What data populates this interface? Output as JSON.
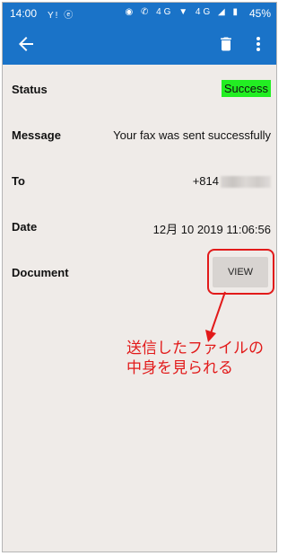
{
  "status_bar": {
    "time": "14:00",
    "left_icons": "Y! ⓔ",
    "right_icons": "◉ ✆ 4G ▼ 4G ◢ ▮",
    "battery": "45%"
  },
  "app_bar": {
    "back_icon": "arrow-left-icon",
    "trash_icon": "trash-icon",
    "more_icon": "more-vert-icon"
  },
  "details": {
    "status": {
      "label": "Status",
      "value": "Success"
    },
    "message": {
      "label": "Message",
      "value": "Your fax was sent successfully"
    },
    "to": {
      "label": "To",
      "value": "+814"
    },
    "date": {
      "label": "Date",
      "value": "12月 10 2019 11:06:56"
    },
    "document": {
      "label": "Document",
      "button": "VIEW"
    }
  },
  "annotation": {
    "line1": "送信したファイルの",
    "line2": "中身を見られる"
  },
  "colors": {
    "app_bar": "#1a73c8",
    "background": "#efebe8",
    "success": "#22ee22",
    "annotation": "#e21a1a"
  }
}
